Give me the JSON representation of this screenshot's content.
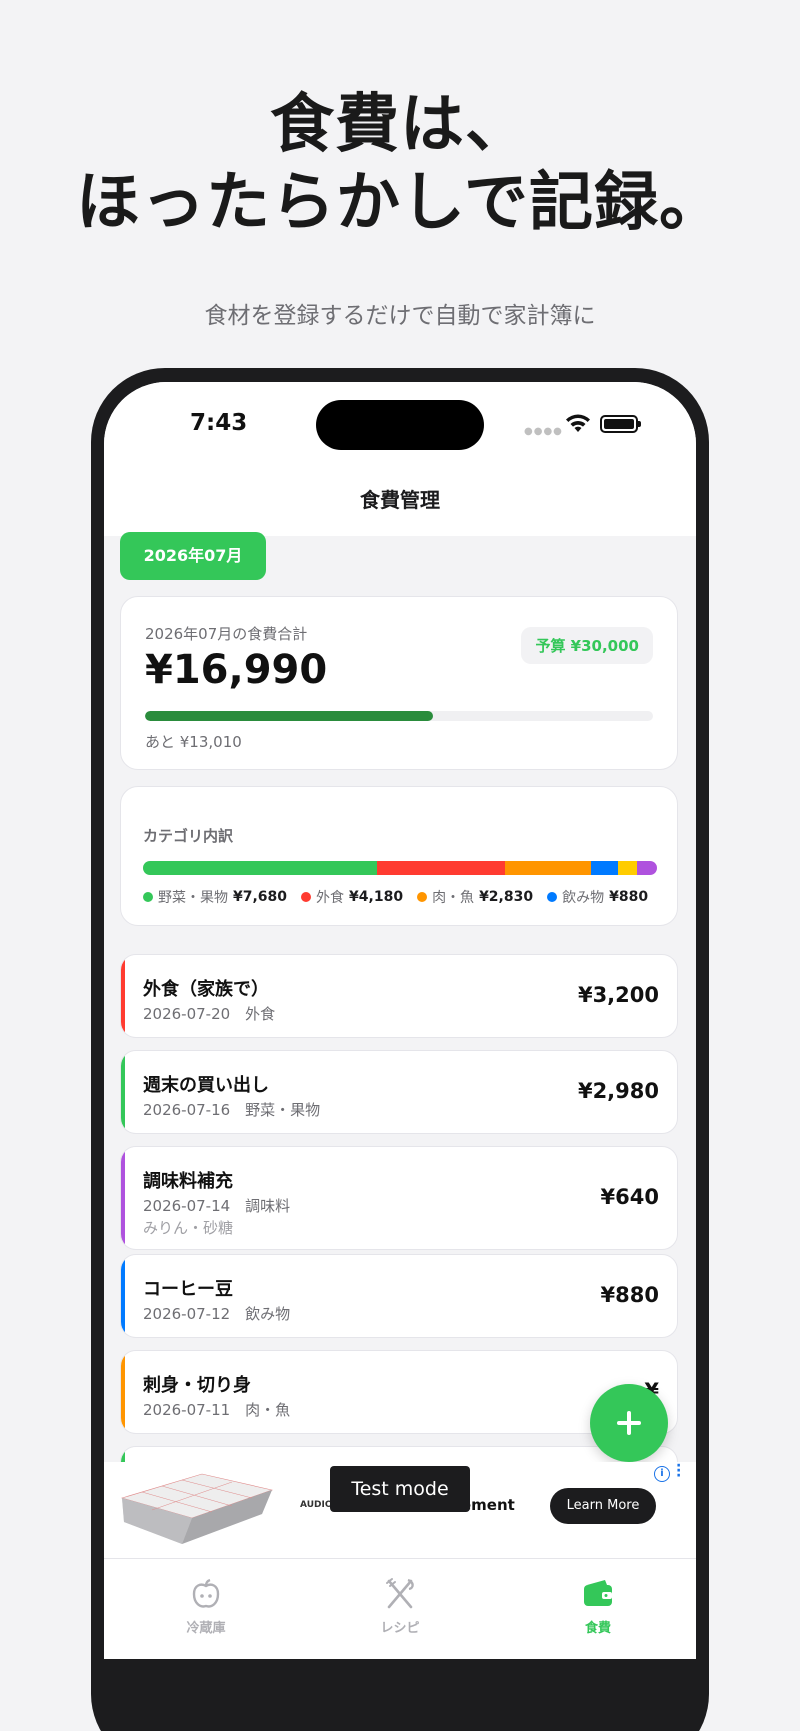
{
  "promo": {
    "headline_line1": "食費は、",
    "headline_line2": "ほったらかしで記録。",
    "subheadline": "食材を登録するだけで自動で家計簿に"
  },
  "status_bar": {
    "time": "7:43"
  },
  "nav": {
    "title": "食費管理"
  },
  "month_selector": {
    "label": "2026年07月"
  },
  "summary": {
    "label": "2026年07月の食費合計",
    "total": "¥16,990",
    "budget_label": "予算 ¥30,000",
    "progress_fraction": 0.5663,
    "remaining": "あと ¥13,010",
    "progress_color": "#2a8c3c"
  },
  "categories": {
    "title": "カテゴリ内訳",
    "segments": [
      {
        "name": "野菜・果物",
        "value": 7680,
        "color": "#34c759"
      },
      {
        "name": "外食",
        "value": 4180,
        "color": "#ff3b30"
      },
      {
        "name": "肉・魚",
        "value": 2830,
        "color": "#ff9500"
      },
      {
        "name": "飲み物",
        "value": 880,
        "color": "#007aff"
      },
      {
        "name": "",
        "value": 640,
        "color": "#ffcc00"
      },
      {
        "name": "調味料",
        "value": 640,
        "color": "#af52de"
      }
    ],
    "legend": [
      {
        "label": "野菜・果物",
        "amount": "¥7,680",
        "color": "#34c759"
      },
      {
        "label": "外食",
        "amount": "¥4,180",
        "color": "#ff3b30"
      },
      {
        "label": "肉・魚",
        "amount": "¥2,830",
        "color": "#ff9500"
      },
      {
        "label": "飲み物",
        "amount": "¥880",
        "color": "#007aff"
      }
    ]
  },
  "entries": [
    {
      "name": "外食（家族で）",
      "meta": "2026-07-20　外食",
      "note": "",
      "amount": "¥3,200",
      "color": "#ff3b30"
    },
    {
      "name": "週末の買い出し",
      "meta": "2026-07-16　野菜・果物",
      "note": "",
      "amount": "¥2,980",
      "color": "#34c759"
    },
    {
      "name": "調味料補充",
      "meta": "2026-07-14　調味料",
      "note": "みりん・砂糖",
      "amount": "¥640",
      "color": "#af52de"
    },
    {
      "name": "コーヒー豆",
      "meta": "2026-07-12　飲み物",
      "note": "",
      "amount": "¥880",
      "color": "#007aff"
    },
    {
      "name": "刺身・切り身",
      "meta": "2026-07-11　肉・魚",
      "note": "",
      "amount": "¥",
      "color": "#ff9500"
    }
  ],
  "ad": {
    "test_mode": "Test mode",
    "brand": "AUDIO",
    "text": "surement",
    "cta": "Learn More",
    "info": "i"
  },
  "tabbar": {
    "tabs": [
      {
        "label": "冷蔵庫",
        "icon": "fridge-apple-icon",
        "active": false
      },
      {
        "label": "レシピ",
        "icon": "fork-knife-icon",
        "active": false
      },
      {
        "label": "食費",
        "icon": "wallet-icon",
        "active": true
      }
    ],
    "active_color": "#34c759",
    "inactive_color": "#b0b0b5"
  }
}
